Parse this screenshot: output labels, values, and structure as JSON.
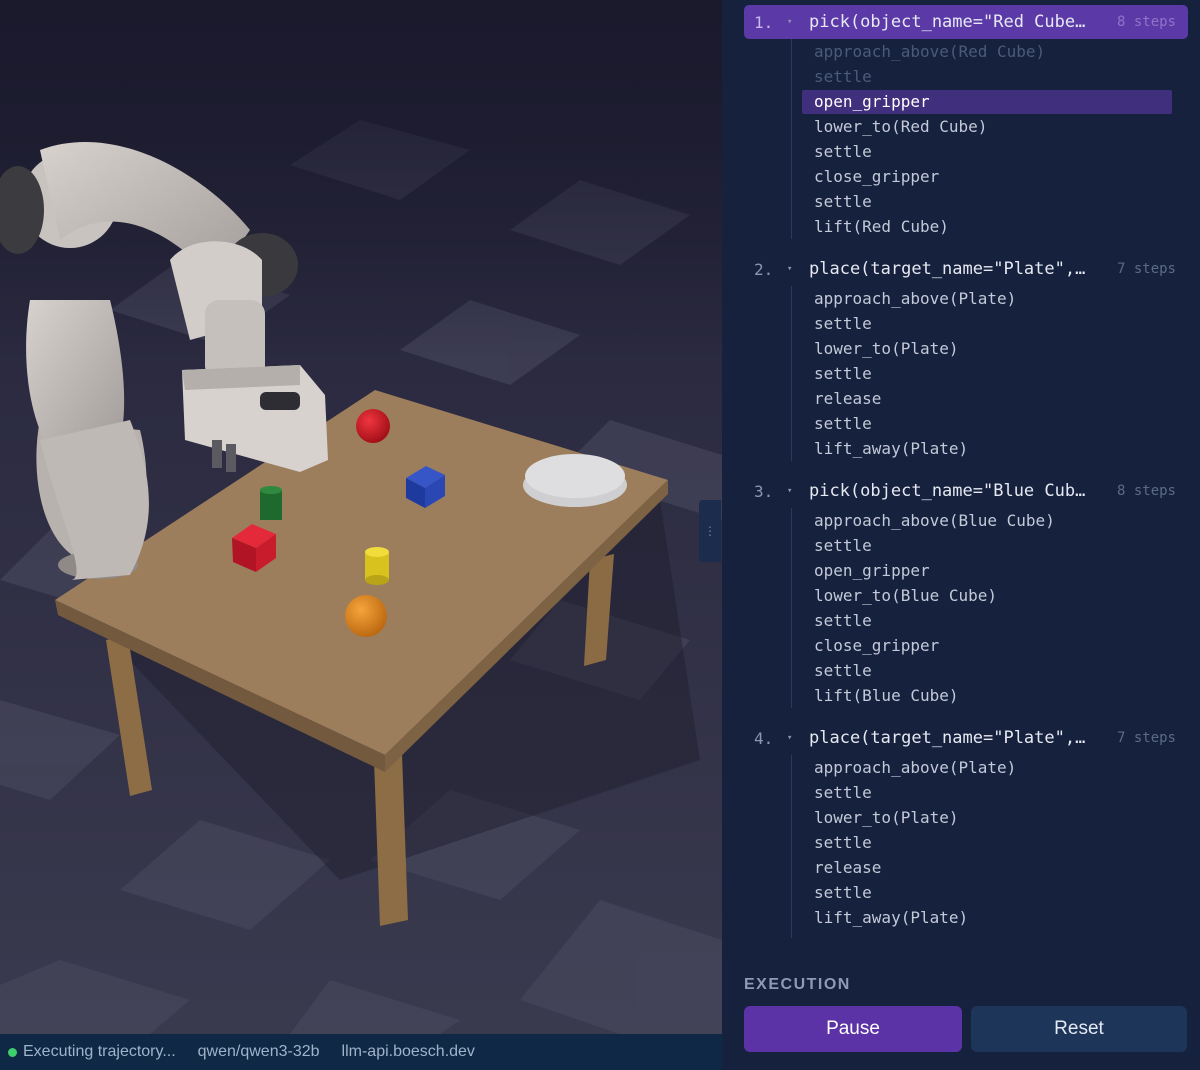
{
  "status": {
    "state": "Executing trajectory...",
    "model": "qwen/qwen3-32b",
    "host": "llm-api.boesch.dev",
    "dot_color": "#3fcf6a"
  },
  "plan": {
    "tasks": [
      {
        "number": "1.",
        "title": "pick(object_name=\"Red Cube…",
        "steps_label": "8 steps",
        "active": true,
        "steps": [
          {
            "label": "approach_above(Red Cube)",
            "state": "done"
          },
          {
            "label": "settle",
            "state": "done"
          },
          {
            "label": "open_gripper",
            "state": "current"
          },
          {
            "label": "lower_to(Red Cube)",
            "state": "pending"
          },
          {
            "label": "settle",
            "state": "pending"
          },
          {
            "label": "close_gripper",
            "state": "pending"
          },
          {
            "label": "settle",
            "state": "pending"
          },
          {
            "label": "lift(Red Cube)",
            "state": "pending"
          }
        ]
      },
      {
        "number": "2.",
        "title": "place(target_name=\"Plate\",…",
        "steps_label": "7 steps",
        "active": false,
        "steps": [
          {
            "label": "approach_above(Plate)",
            "state": "pending"
          },
          {
            "label": "settle",
            "state": "pending"
          },
          {
            "label": "lower_to(Plate)",
            "state": "pending"
          },
          {
            "label": "settle",
            "state": "pending"
          },
          {
            "label": "release",
            "state": "pending"
          },
          {
            "label": "settle",
            "state": "pending"
          },
          {
            "label": "lift_away(Plate)",
            "state": "pending"
          }
        ]
      },
      {
        "number": "3.",
        "title": "pick(object_name=\"Blue Cub…",
        "steps_label": "8 steps",
        "active": false,
        "steps": [
          {
            "label": "approach_above(Blue Cube)",
            "state": "pending"
          },
          {
            "label": "settle",
            "state": "pending"
          },
          {
            "label": "open_gripper",
            "state": "pending"
          },
          {
            "label": "lower_to(Blue Cube)",
            "state": "pending"
          },
          {
            "label": "settle",
            "state": "pending"
          },
          {
            "label": "close_gripper",
            "state": "pending"
          },
          {
            "label": "settle",
            "state": "pending"
          },
          {
            "label": "lift(Blue Cube)",
            "state": "pending"
          }
        ]
      },
      {
        "number": "4.",
        "title": "place(target_name=\"Plate\",…",
        "steps_label": "7 steps",
        "active": false,
        "steps": [
          {
            "label": "approach_above(Plate)",
            "state": "pending"
          },
          {
            "label": "settle",
            "state": "pending"
          },
          {
            "label": "lower_to(Plate)",
            "state": "pending"
          },
          {
            "label": "settle",
            "state": "pending"
          },
          {
            "label": "release",
            "state": "pending"
          },
          {
            "label": "settle",
            "state": "pending"
          },
          {
            "label": "lift_away(Plate)",
            "state": "pending"
          }
        ]
      }
    ]
  },
  "execution": {
    "section_label": "EXECUTION",
    "pause_label": "Pause",
    "reset_label": "Reset"
  },
  "colors": {
    "accent": "#5b33a6",
    "current_step_bg": "#3f2f7d",
    "panel_bg": "#15213d",
    "status_bg": "#0f2846"
  }
}
